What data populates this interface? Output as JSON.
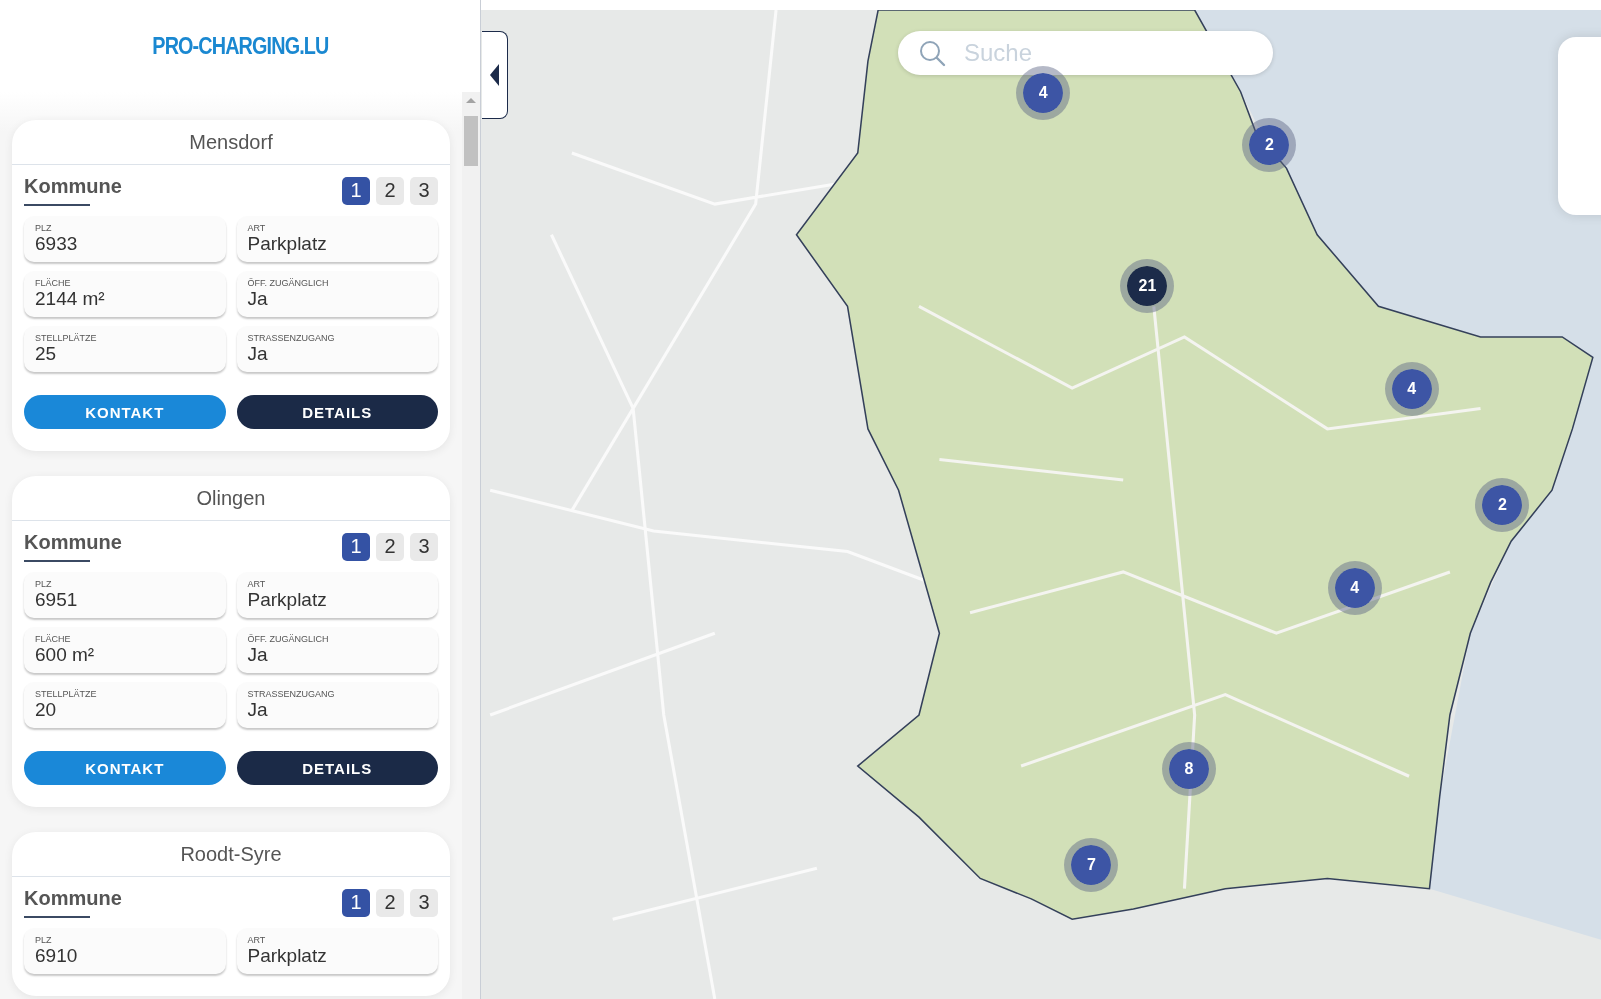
{
  "brand": "PRO-CHARGING.LU",
  "sites": [
    {
      "name": "Mensdorf",
      "section": "Kommune",
      "pages": [
        {
          "label": "1",
          "selected": true
        },
        {
          "label": "2",
          "selected": false
        },
        {
          "label": "3",
          "selected": false
        }
      ],
      "fields": [
        {
          "label": "PLZ",
          "value": "6933"
        },
        {
          "label": "ART",
          "value": "Parkplatz"
        },
        {
          "label": "FLÄCHE",
          "value": "2144 m²"
        },
        {
          "label": "ÖFF. ZUGÄNGLICH",
          "value": "Ja"
        },
        {
          "label": "STELLPLÄTZE",
          "value": "25"
        },
        {
          "label": "STRASSENZUGANG",
          "value": "Ja"
        }
      ],
      "buttons": [
        {
          "label": "KONTAKT",
          "kind": "primary"
        },
        {
          "label": "DETAILS",
          "kind": "secondary"
        }
      ]
    },
    {
      "name": "Olingen",
      "section": "Kommune",
      "pages": [
        {
          "label": "1",
          "selected": true
        },
        {
          "label": "2",
          "selected": false
        },
        {
          "label": "3",
          "selected": false
        }
      ],
      "fields": [
        {
          "label": "PLZ",
          "value": "6951"
        },
        {
          "label": "ART",
          "value": "Parkplatz"
        },
        {
          "label": "FLÄCHE",
          "value": "600 m²"
        },
        {
          "label": "ÖFF. ZUGÄNGLICH",
          "value": "Ja"
        },
        {
          "label": "STELLPLÄTZE",
          "value": "20"
        },
        {
          "label": "STRASSENZUGANG",
          "value": "Ja"
        }
      ],
      "buttons": [
        {
          "label": "KONTAKT",
          "kind": "primary"
        },
        {
          "label": "DETAILS",
          "kind": "secondary"
        }
      ]
    },
    {
      "name": "Roodt-Syre",
      "section": "Kommune",
      "pages": [
        {
          "label": "1",
          "selected": true
        },
        {
          "label": "2",
          "selected": false
        },
        {
          "label": "3",
          "selected": false
        }
      ],
      "fields": [
        {
          "label": "PLZ",
          "value": "6910"
        },
        {
          "label": "ART",
          "value": "Parkplatz"
        }
      ]
    }
  ],
  "map": {
    "search": {
      "placeholder": "Suche"
    },
    "clusters": [
      {
        "count": "4",
        "color": "#3d55a5"
      },
      {
        "count": "2",
        "color": "#3d55a5"
      },
      {
        "count": "21",
        "color": "#1c2b4a"
      },
      {
        "count": "4",
        "color": "#3d55a5"
      },
      {
        "count": "2",
        "color": "#3d55a5"
      },
      {
        "count": "4",
        "color": "#3d55a5"
      },
      {
        "count": "8",
        "color": "#3d55a5"
      },
      {
        "count": "7",
        "color": "#3d55a5"
      }
    ]
  }
}
